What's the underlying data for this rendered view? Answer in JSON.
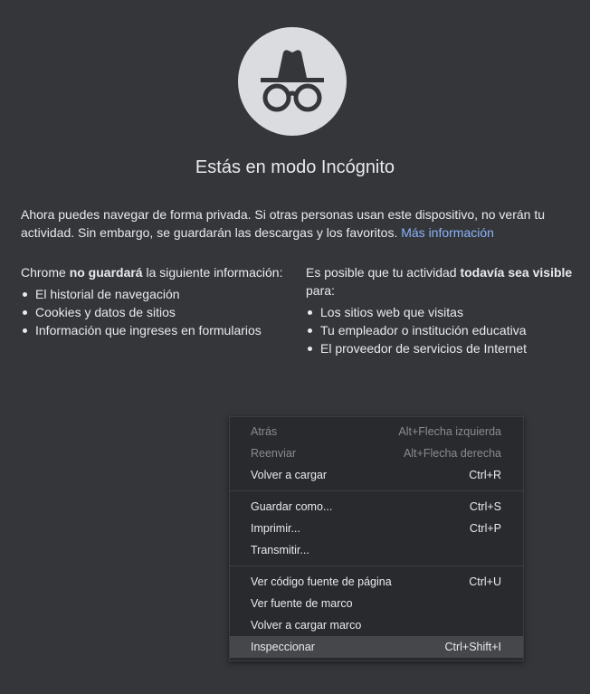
{
  "colors": {
    "background": "#35363a",
    "logo_circle": "#dadce0",
    "logo_glyph": "#35363a",
    "link": "#8ab4f8",
    "menu_bg": "#292a2d",
    "menu_hover": "#46474b",
    "menu_disabled_text": "#8a8b8e"
  },
  "logo": {
    "icon": "incognito-icon"
  },
  "page": {
    "title": "Estás en modo Incógnito",
    "intro_text": "Ahora puedes navegar de forma privada. Si otras personas usan este dispositivo, no verán tu actividad. Sin embargo, se guardarán las descargas y los favoritos.",
    "learn_more": "Más información"
  },
  "left_column": {
    "heading_prefix": "Chrome ",
    "heading_bold": "no guardará",
    "heading_suffix": " la siguiente información:",
    "items": [
      "El historial de navegación",
      "Cookies y datos de sitios",
      "Información que ingreses en formularios"
    ]
  },
  "right_column": {
    "heading_prefix": "Es posible que tu actividad ",
    "heading_bold": "todavía sea visible",
    "heading_suffix": " para:",
    "items": [
      "Los sitios web que visitas",
      "Tu empleador o institución educativa",
      "El proveedor de servicios de Internet"
    ]
  },
  "context_menu": {
    "groups": [
      [
        {
          "label": "Atrás",
          "shortcut": "Alt+Flecha izquierda",
          "disabled": true
        },
        {
          "label": "Reenviar",
          "shortcut": "Alt+Flecha derecha",
          "disabled": true
        },
        {
          "label": "Volver a cargar",
          "shortcut": "Ctrl+R",
          "disabled": false
        }
      ],
      [
        {
          "label": "Guardar como...",
          "shortcut": "Ctrl+S",
          "disabled": false
        },
        {
          "label": "Imprimir...",
          "shortcut": "Ctrl+P",
          "disabled": false
        },
        {
          "label": "Transmitir...",
          "shortcut": "",
          "disabled": false
        }
      ],
      [
        {
          "label": "Ver código fuente de página",
          "shortcut": "Ctrl+U",
          "disabled": false
        },
        {
          "label": "Ver fuente de marco",
          "shortcut": "",
          "disabled": false
        },
        {
          "label": "Volver a cargar marco",
          "shortcut": "",
          "disabled": false
        },
        {
          "label": "Inspeccionar",
          "shortcut": "Ctrl+Shift+I",
          "disabled": false,
          "highlighted": true
        }
      ]
    ]
  }
}
